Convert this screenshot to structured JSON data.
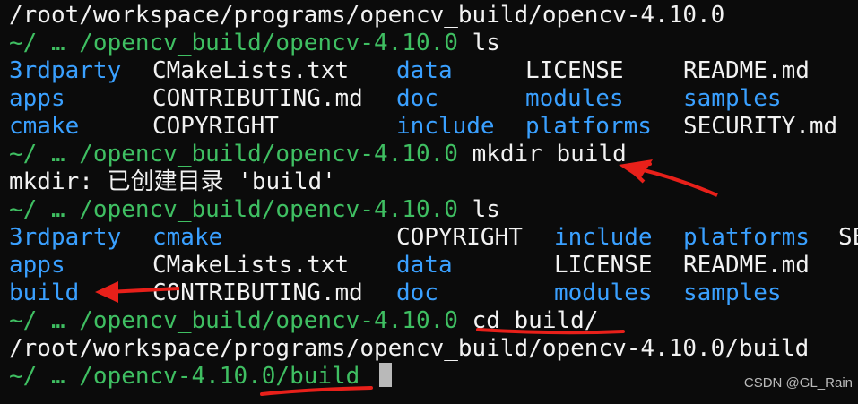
{
  "terminal": {
    "lines": [
      {
        "kind": "output",
        "text": "/root/workspace/programs/opencv_build/opencv-4.10.0"
      },
      {
        "kind": "prompt",
        "prompt": "~/ … /opencv_build/opencv-4.10.0",
        "command": "ls"
      },
      {
        "kind": "ls",
        "cells": [
          {
            "text": "3rdparty",
            "type": "dir"
          },
          {
            "text": "CMakeLists.txt",
            "type": "file"
          },
          {
            "text": "data",
            "type": "dir"
          },
          {
            "text": "LICENSE",
            "type": "file"
          },
          {
            "text": "README.md",
            "type": "file"
          }
        ]
      },
      {
        "kind": "ls",
        "cells": [
          {
            "text": "apps",
            "type": "dir"
          },
          {
            "text": "CONTRIBUTING.md",
            "type": "file"
          },
          {
            "text": "doc",
            "type": "dir"
          },
          {
            "text": "modules",
            "type": "dir"
          },
          {
            "text": "samples",
            "type": "dir"
          }
        ]
      },
      {
        "kind": "ls",
        "cells": [
          {
            "text": "cmake",
            "type": "dir"
          },
          {
            "text": "COPYRIGHT",
            "type": "file"
          },
          {
            "text": "include",
            "type": "dir"
          },
          {
            "text": "platforms",
            "type": "dir"
          },
          {
            "text": "SECURITY.md",
            "type": "file"
          }
        ]
      },
      {
        "kind": "prompt",
        "prompt": "~/ … /opencv_build/opencv-4.10.0",
        "command": "mkdir build"
      },
      {
        "kind": "output",
        "text": "mkdir: 已创建目录 'build'"
      },
      {
        "kind": "prompt",
        "prompt": "~/ … /opencv_build/opencv-4.10.0",
        "command": "ls"
      },
      {
        "kind": "ls",
        "cells": [
          {
            "text": "3rdparty",
            "type": "dir"
          },
          {
            "text": "cmake",
            "type": "dir"
          },
          {
            "text": "COPYRIGHT",
            "type": "file"
          },
          {
            "text": "include",
            "type": "dir"
          },
          {
            "text": "platforms",
            "type": "dir"
          },
          {
            "text": "SE",
            "type": "file"
          }
        ]
      },
      {
        "kind": "ls",
        "cells": [
          {
            "text": "apps",
            "type": "dir"
          },
          {
            "text": "CMakeLists.txt",
            "type": "file"
          },
          {
            "text": "data",
            "type": "dir"
          },
          {
            "text": "LICENSE",
            "type": "file"
          },
          {
            "text": "README.md",
            "type": "file"
          }
        ]
      },
      {
        "kind": "ls",
        "cells": [
          {
            "text": "build",
            "type": "dir"
          },
          {
            "text": "CONTRIBUTING.md",
            "type": "file"
          },
          {
            "text": "doc",
            "type": "dir"
          },
          {
            "text": "modules",
            "type": "dir"
          },
          {
            "text": "samples",
            "type": "dir"
          }
        ]
      },
      {
        "kind": "prompt",
        "prompt": "~/ … /opencv_build/opencv-4.10.0",
        "command": "cd build/"
      },
      {
        "kind": "output",
        "text": "/root/workspace/programs/opencv_build/opencv-4.10.0/build"
      },
      {
        "kind": "prompt",
        "prompt": "~/ … /opencv-4.10.0/build",
        "command": "",
        "cursor": true
      }
    ]
  },
  "watermark": "CSDN @GL_Rain",
  "colors": {
    "prompt": "#3fbf62",
    "directory": "#3aa0ff",
    "text": "#f2f2f2",
    "annotation": "#e8201a"
  }
}
